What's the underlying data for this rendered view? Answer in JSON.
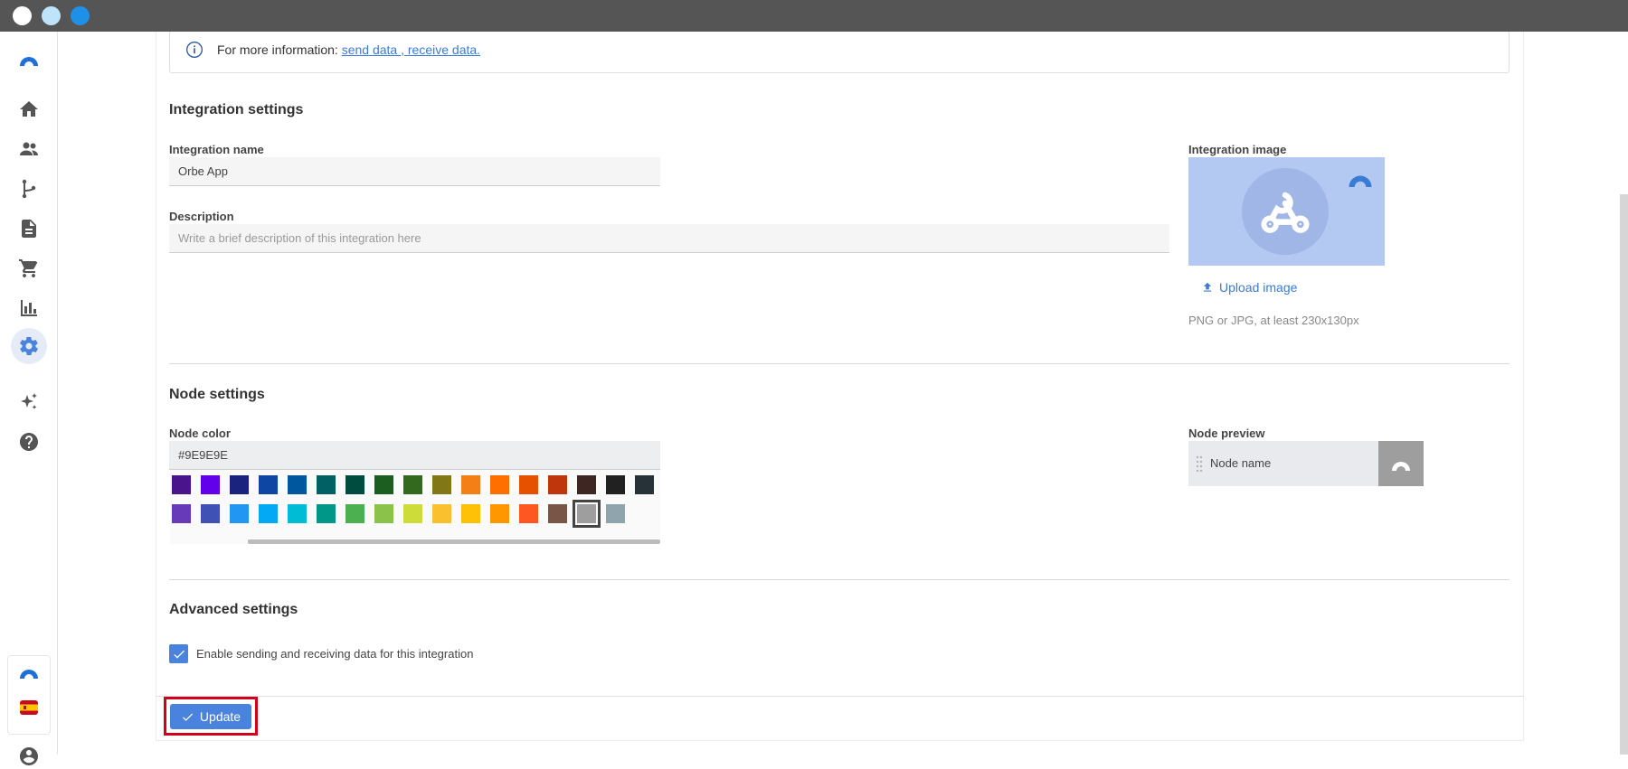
{
  "colors": {
    "titlebar": "#555555",
    "accent": "#4a83dd",
    "link": "#3a7bd5",
    "highlight_border": "#d0021b"
  },
  "sidebar": {
    "items": [
      {
        "icon": "home-icon"
      },
      {
        "icon": "users-icon"
      },
      {
        "icon": "branch-icon"
      },
      {
        "icon": "document-icon"
      },
      {
        "icon": "cart-icon"
      },
      {
        "icon": "bar-chart-icon"
      },
      {
        "icon": "gear-icon",
        "active": true
      },
      {
        "icon": "sparkles-icon"
      },
      {
        "icon": "help-icon"
      }
    ]
  },
  "info": {
    "prefix": "For more information: ",
    "link_send": "send data ",
    "separator": ", ",
    "link_receive": "receive data."
  },
  "integration": {
    "title": "Integration settings",
    "name_label": "Integration name",
    "name_value": "Orbe App",
    "description_label": "Description",
    "description_placeholder": "Write a brief description of this integration here",
    "image_label": "Integration image",
    "upload_label": "Upload image",
    "image_hint": "PNG or JPG, at least 230x130px"
  },
  "node": {
    "title": "Node settings",
    "color_label": "Node color",
    "color_value": "#9E9E9E",
    "palette_row1": [
      "#4a148c",
      "#6200ea",
      "#1a237e",
      "#0d47a1",
      "#01579b",
      "#006064",
      "#004d40",
      "#1b5e20",
      "#33691e",
      "#827717",
      "#f57f17",
      "#ff6f00",
      "#e65100",
      "#bf360c",
      "#3e2723",
      "#212121",
      "#263238"
    ],
    "palette_row2": [
      "#673ab7",
      "#3f51b5",
      "#2196f3",
      "#03a9f4",
      "#00bcd4",
      "#009688",
      "#4caf50",
      "#8bc34a",
      "#cddc39",
      "#fbc02d",
      "#ffc107",
      "#ff9800",
      "#ff5722",
      "#795548",
      "#9e9e9e",
      "#90a4ae"
    ],
    "preview_label": "Node preview",
    "preview_name": "Node name"
  },
  "advanced": {
    "title": "Advanced settings",
    "enable_label": "Enable sending and receiving data for this integration",
    "enabled": true
  },
  "footer": {
    "update_label": "Update"
  }
}
